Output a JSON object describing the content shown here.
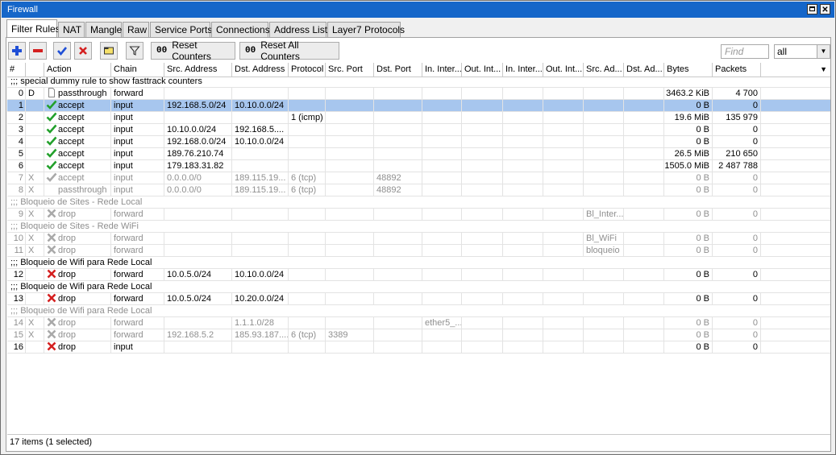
{
  "window": {
    "title": "Firewall"
  },
  "tabs": [
    {
      "label": "Filter Rules"
    },
    {
      "label": "NAT"
    },
    {
      "label": "Mangle"
    },
    {
      "label": "Raw"
    },
    {
      "label": "Service Ports"
    },
    {
      "label": "Connections"
    },
    {
      "label": "Address Lists"
    },
    {
      "label": "Layer7 Protocols"
    }
  ],
  "toolbar": {
    "add_icon": "plus-icon",
    "remove_icon": "minus-icon",
    "enable_icon": "check-icon",
    "disable_icon": "x-icon",
    "comment_icon": "note-icon",
    "filter_icon": "filter-icon",
    "reset_counters_prefix": "00",
    "reset_counters_label": "Reset Counters",
    "reset_all_prefix": "00",
    "reset_all_label": "Reset All Counters",
    "find_placeholder": "Find",
    "scope_value": "all"
  },
  "columns": [
    "#",
    "",
    "Action",
    "Chain",
    "Src. Address",
    "Dst. Address",
    "Protocol",
    "Src. Port",
    "Dst. Port",
    "In. Inter...",
    "Out. Int...",
    "In. Inter...",
    "Out. Int...",
    "Src. Ad...",
    "Dst. Ad...",
    "Bytes",
    "Packets"
  ],
  "rows": [
    {
      "type": "comment",
      "text": ";;; special dummy rule to show fasttrack counters",
      "disabled": false
    },
    {
      "type": "rule",
      "num": "0",
      "flag": "D",
      "action": "passthrough",
      "icon": "page",
      "chain": "forward",
      "src": "",
      "dst": "",
      "proto": "",
      "sport": "",
      "dport": "",
      "in1": "",
      "out1": "",
      "in2": "",
      "out2": "",
      "srcl": "",
      "dstl": "",
      "bytes": "3463.2 KiB",
      "packets": "4 700",
      "disabled": false,
      "selected": false
    },
    {
      "type": "rule",
      "num": "1",
      "flag": "",
      "action": "accept",
      "icon": "accept",
      "chain": "input",
      "src": "192.168.5.0/24",
      "dst": "10.10.0.0/24",
      "proto": "",
      "sport": "",
      "dport": "",
      "in1": "",
      "out1": "",
      "in2": "",
      "out2": "",
      "srcl": "",
      "dstl": "",
      "bytes": "0 B",
      "packets": "0",
      "disabled": false,
      "selected": true
    },
    {
      "type": "rule",
      "num": "2",
      "flag": "",
      "action": "accept",
      "icon": "accept",
      "chain": "input",
      "src": "",
      "dst": "",
      "proto": "1 (icmp)",
      "sport": "",
      "dport": "",
      "in1": "",
      "out1": "",
      "in2": "",
      "out2": "",
      "srcl": "",
      "dstl": "",
      "bytes": "19.6 MiB",
      "packets": "135 979",
      "disabled": false,
      "selected": false
    },
    {
      "type": "rule",
      "num": "3",
      "flag": "",
      "action": "accept",
      "icon": "accept",
      "chain": "input",
      "src": "10.10.0.0/24",
      "dst": "192.168.5....",
      "proto": "",
      "sport": "",
      "dport": "",
      "in1": "",
      "out1": "",
      "in2": "",
      "out2": "",
      "srcl": "",
      "dstl": "",
      "bytes": "0 B",
      "packets": "0",
      "disabled": false,
      "selected": false
    },
    {
      "type": "rule",
      "num": "4",
      "flag": "",
      "action": "accept",
      "icon": "accept",
      "chain": "input",
      "src": "192.168.0.0/24",
      "dst": "10.10.0.0/24",
      "proto": "",
      "sport": "",
      "dport": "",
      "in1": "",
      "out1": "",
      "in2": "",
      "out2": "",
      "srcl": "",
      "dstl": "",
      "bytes": "0 B",
      "packets": "0",
      "disabled": false,
      "selected": false
    },
    {
      "type": "rule",
      "num": "5",
      "flag": "",
      "action": "accept",
      "icon": "accept",
      "chain": "input",
      "src": "189.76.210.74",
      "dst": "",
      "proto": "",
      "sport": "",
      "dport": "",
      "in1": "",
      "out1": "",
      "in2": "",
      "out2": "",
      "srcl": "",
      "dstl": "",
      "bytes": "26.5 MiB",
      "packets": "210 650",
      "disabled": false,
      "selected": false
    },
    {
      "type": "rule",
      "num": "6",
      "flag": "",
      "action": "accept",
      "icon": "accept",
      "chain": "input",
      "src": "179.183.31.82",
      "dst": "",
      "proto": "",
      "sport": "",
      "dport": "",
      "in1": "",
      "out1": "",
      "in2": "",
      "out2": "",
      "srcl": "",
      "dstl": "",
      "bytes": "1505.0 MiB",
      "packets": "2 487 788",
      "disabled": false,
      "selected": false
    },
    {
      "type": "rule",
      "num": "7",
      "flag": "X",
      "action": "accept",
      "icon": "accept",
      "chain": "input",
      "src": "0.0.0.0/0",
      "dst": "189.115.19...",
      "proto": "6 (tcp)",
      "sport": "",
      "dport": "48892",
      "in1": "",
      "out1": "",
      "in2": "",
      "out2": "",
      "srcl": "",
      "dstl": "",
      "bytes": "0 B",
      "packets": "0",
      "disabled": true,
      "selected": false
    },
    {
      "type": "rule",
      "num": "8",
      "flag": "X",
      "action": "passthrough",
      "icon": "none",
      "chain": "input",
      "src": "0.0.0.0/0",
      "dst": "189.115.19...",
      "proto": "6 (tcp)",
      "sport": "",
      "dport": "48892",
      "in1": "",
      "out1": "",
      "in2": "",
      "out2": "",
      "srcl": "",
      "dstl": "",
      "bytes": "0 B",
      "packets": "0",
      "disabled": true,
      "selected": false
    },
    {
      "type": "comment",
      "text": ";;; Bloqueio de Sites - Rede Local",
      "disabled": true
    },
    {
      "type": "rule",
      "num": "9",
      "flag": "X",
      "action": "drop",
      "icon": "drop",
      "chain": "forward",
      "src": "",
      "dst": "",
      "proto": "",
      "sport": "",
      "dport": "",
      "in1": "",
      "out1": "",
      "in2": "",
      "out2": "",
      "srcl": "Bl_Inter...",
      "dstl": "",
      "bytes": "0 B",
      "packets": "0",
      "disabled": true,
      "selected": false
    },
    {
      "type": "comment",
      "text": ";;; Bloqueio de Sites - Rede WiFi",
      "disabled": true
    },
    {
      "type": "rule",
      "num": "10",
      "flag": "X",
      "action": "drop",
      "icon": "drop",
      "chain": "forward",
      "src": "",
      "dst": "",
      "proto": "",
      "sport": "",
      "dport": "",
      "in1": "",
      "out1": "",
      "in2": "",
      "out2": "",
      "srcl": "Bl_WiFi",
      "dstl": "",
      "bytes": "0 B",
      "packets": "0",
      "disabled": true,
      "selected": false
    },
    {
      "type": "rule",
      "num": "11",
      "flag": "X",
      "action": "drop",
      "icon": "drop",
      "chain": "forward",
      "src": "",
      "dst": "",
      "proto": "",
      "sport": "",
      "dport": "",
      "in1": "",
      "out1": "",
      "in2": "",
      "out2": "",
      "srcl": "bloqueio",
      "dstl": "",
      "bytes": "0 B",
      "packets": "0",
      "disabled": true,
      "selected": false
    },
    {
      "type": "comment",
      "text": ";;; Bloqueio de Wifi para Rede Local",
      "disabled": false
    },
    {
      "type": "rule",
      "num": "12",
      "flag": "",
      "action": "drop",
      "icon": "drop",
      "chain": "forward",
      "src": "10.0.5.0/24",
      "dst": "10.10.0.0/24",
      "proto": "",
      "sport": "",
      "dport": "",
      "in1": "",
      "out1": "",
      "in2": "",
      "out2": "",
      "srcl": "",
      "dstl": "",
      "bytes": "0 B",
      "packets": "0",
      "disabled": false,
      "selected": false
    },
    {
      "type": "comment",
      "text": ";;; Bloqueio de Wifi para Rede Local",
      "disabled": false
    },
    {
      "type": "rule",
      "num": "13",
      "flag": "",
      "action": "drop",
      "icon": "drop",
      "chain": "forward",
      "src": "10.0.5.0/24",
      "dst": "10.20.0.0/24",
      "proto": "",
      "sport": "",
      "dport": "",
      "in1": "",
      "out1": "",
      "in2": "",
      "out2": "",
      "srcl": "",
      "dstl": "",
      "bytes": "0 B",
      "packets": "0",
      "disabled": false,
      "selected": false
    },
    {
      "type": "comment",
      "text": ";;; Bloqueio de Wifi para Rede Local",
      "disabled": true
    },
    {
      "type": "rule",
      "num": "14",
      "flag": "X",
      "action": "drop",
      "icon": "drop",
      "chain": "forward",
      "src": "",
      "dst": "1.1.1.0/28",
      "proto": "",
      "sport": "",
      "dport": "",
      "in1": "ether5_...",
      "out1": "",
      "in2": "",
      "out2": "",
      "srcl": "",
      "dstl": "",
      "bytes": "0 B",
      "packets": "0",
      "disabled": true,
      "selected": false
    },
    {
      "type": "rule",
      "num": "15",
      "flag": "X",
      "action": "drop",
      "icon": "drop",
      "chain": "forward",
      "src": "192.168.5.2",
      "dst": "185.93.187....",
      "proto": "6 (tcp)",
      "sport": "3389",
      "dport": "",
      "in1": "",
      "out1": "",
      "in2": "",
      "out2": "",
      "srcl": "",
      "dstl": "",
      "bytes": "0 B",
      "packets": "0",
      "disabled": true,
      "selected": false
    },
    {
      "type": "rule",
      "num": "16",
      "flag": "",
      "action": "drop",
      "icon": "drop",
      "chain": "input",
      "src": "",
      "dst": "",
      "proto": "",
      "sport": "",
      "dport": "",
      "in1": "",
      "out1": "",
      "in2": "",
      "out2": "",
      "srcl": "",
      "dstl": "",
      "bytes": "0 B",
      "packets": "0",
      "disabled": false,
      "selected": false
    }
  ],
  "status": {
    "text": "17 items (1 selected)"
  },
  "colors": {
    "titlebar": "#1566c9",
    "selected_row": "#a7c6ee",
    "accept": "#22a02b",
    "drop": "#d42020",
    "disabled_text": "#8f8f8f"
  }
}
